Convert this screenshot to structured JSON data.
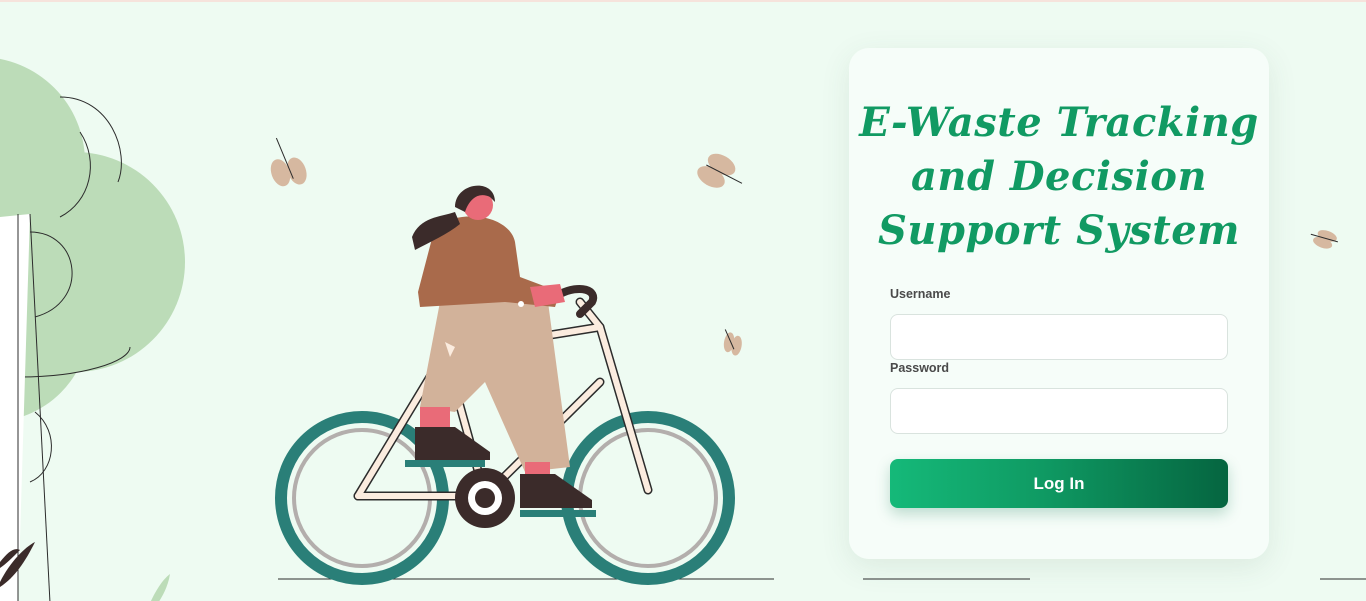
{
  "login": {
    "title_lines": [
      "E-Waste Tracking",
      "and Decision",
      "Support System"
    ],
    "username_label": "Username",
    "username_value": "",
    "password_label": "Password",
    "password_value": "",
    "login_button": "Log In"
  },
  "colors": {
    "background": "#eefbf2",
    "accent": "#119a63",
    "button_dark": "#056540",
    "wheel": "#2a7f78",
    "tree": "#bcdcb8",
    "leaf": "#d6b8a0"
  }
}
